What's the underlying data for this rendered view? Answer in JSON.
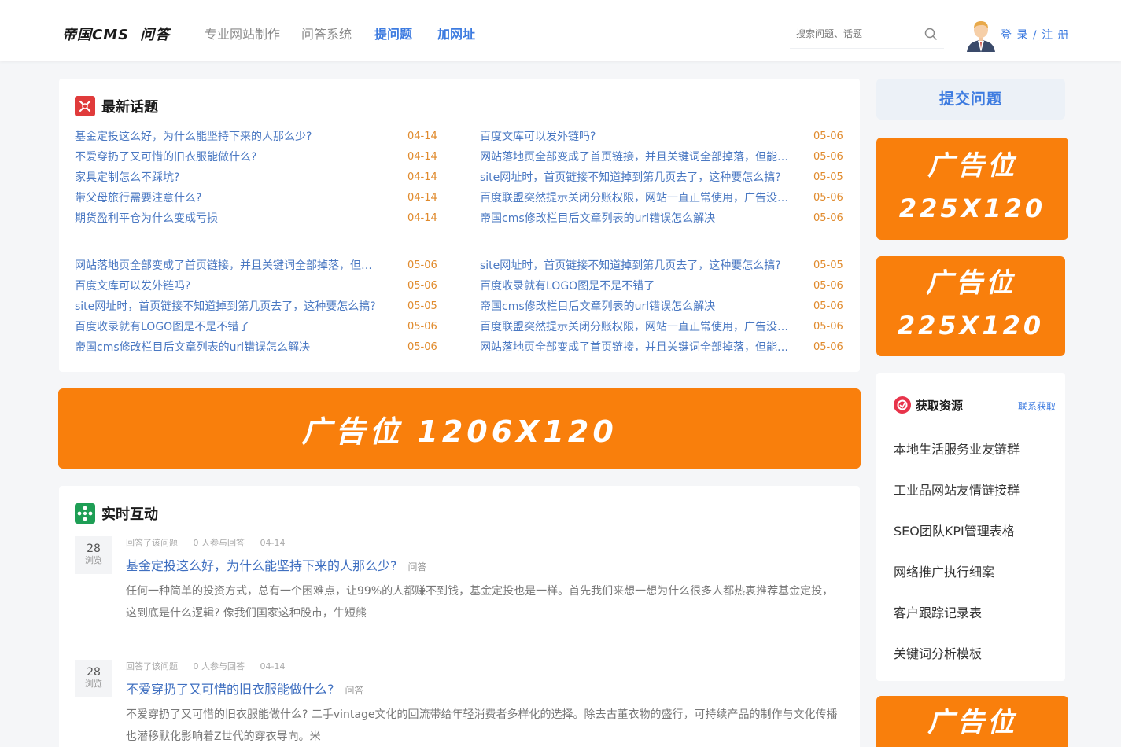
{
  "header": {
    "logo_main": "帝国CMS",
    "logo_sub": "问答",
    "nav": [
      "专业网站制作",
      "问答系统",
      "提问题",
      "加网址"
    ],
    "search_placeholder": "搜索问题、话题",
    "login_label": "登 录 / 注 册",
    "search_icon": "search-icon",
    "avatar_icon": "user-avatar"
  },
  "latest": {
    "title": "最新话题",
    "groups": [
      {
        "left": [
          {
            "title": "基金定投这么好，为什么能坚持下来的人那么少?",
            "date": "04-14"
          },
          {
            "title": "不爱穿扔了又可惜的旧衣服能做什么?",
            "date": "04-14"
          },
          {
            "title": "家具定制怎么不踩坑?",
            "date": "04-14"
          },
          {
            "title": "带父母旅行需要注意什么?",
            "date": "04-14"
          },
          {
            "title": "期货盈利平仓为什么变成亏损",
            "date": "04-14"
          }
        ],
        "right": [
          {
            "title": "百度文库可以发外链吗?",
            "date": "05-06"
          },
          {
            "title": "网站落地页全部变成了首页链接，并且关键词全部掉落，但能…",
            "date": "05-06"
          },
          {
            "title": "site网址时，首页链接不知道掉到第几页去了，这种要怎么搞?",
            "date": "05-05"
          },
          {
            "title": "百度联盟突然提示关闭分账权限，网站一直正常使用，广告没…",
            "date": "05-06"
          },
          {
            "title": "帝国cms修改栏目后文章列表的url错误怎么解决",
            "date": "05-06"
          }
        ]
      },
      {
        "left": [
          {
            "title": "网站落地页全部变成了首页链接，并且关键词全部掉落，但…",
            "date": "05-06"
          },
          {
            "title": "百度文库可以发外链吗?",
            "date": "05-06"
          },
          {
            "title": "site网址时，首页链接不知道掉到第几页去了，这种要怎么搞?",
            "date": "05-05"
          },
          {
            "title": "百度收录就有LOGO图是不是不错了",
            "date": "05-06"
          },
          {
            "title": "帝国cms修改栏目后文章列表的url错误怎么解决",
            "date": "05-06"
          }
        ],
        "right": [
          {
            "title": "site网址时，首页链接不知道掉到第几页去了，这种要怎么搞?",
            "date": "05-05"
          },
          {
            "title": "百度收录就有LOGO图是不是不错了",
            "date": "05-06"
          },
          {
            "title": "帝国cms修改栏目后文章列表的url错误怎么解决",
            "date": "05-06"
          },
          {
            "title": "百度联盟突然提示关闭分账权限，网站一直正常使用，广告没…",
            "date": "05-06"
          },
          {
            "title": "网站落地页全部变成了首页链接，并且关键词全部掉落，但能…",
            "date": "05-06"
          }
        ]
      }
    ]
  },
  "banner": {
    "text": "广告位 1206X120"
  },
  "live": {
    "title": "实时互动",
    "items": [
      {
        "views": "28",
        "views_label": "浏览",
        "action": "回答了该问题",
        "participants": "0 人参与回答",
        "date": "04-14",
        "title": "基金定投这么好，为什么能坚持下来的人那么少?",
        "tag": "问答",
        "body": "任何一种简单的投资方式，总有一个困难点，让99%的人都赚不到钱，基金定投也是一样。首先我们来想一想为什么很多人都热衷推荐基金定投，这到底是什么逻辑? 像我们国家这种股市，牛短熊"
      },
      {
        "views": "28",
        "views_label": "浏览",
        "action": "回答了该问题",
        "participants": "0 人参与回答",
        "date": "04-14",
        "title": "不爱穿扔了又可惜的旧衣服能做什么?",
        "tag": "问答",
        "body": "不爱穿扔了又可惜的旧衣服能做什么? 二手vintage文化的回流带给年轻消费者多样化的选择。除去古董衣物的盛行，可持续产品的制作与文化传播也潜移默化影响着Z世代的穿衣导向。米"
      }
    ]
  },
  "sidebar": {
    "submit_label": "提交问题",
    "ads": [
      {
        "line1": "广告位",
        "line2": "225X120"
      },
      {
        "line1": "广告位",
        "line2": "225X120"
      },
      {
        "line1": "广告位",
        "line2": ""
      }
    ],
    "resources": {
      "title": "获取资源",
      "more": "联系获取",
      "items": [
        "本地生活服务业友链群",
        "工业品网站友情链接群",
        "SEO团队KPI管理表格",
        "网络推广执行细案",
        "客户跟踪记录表",
        "关键词分析模板"
      ]
    }
  },
  "colors": {
    "accent_blue": "#3d7be0",
    "ad_orange": "#f97f0c",
    "date_orange": "#e08a2c",
    "link_blue": "#4a78c2"
  }
}
